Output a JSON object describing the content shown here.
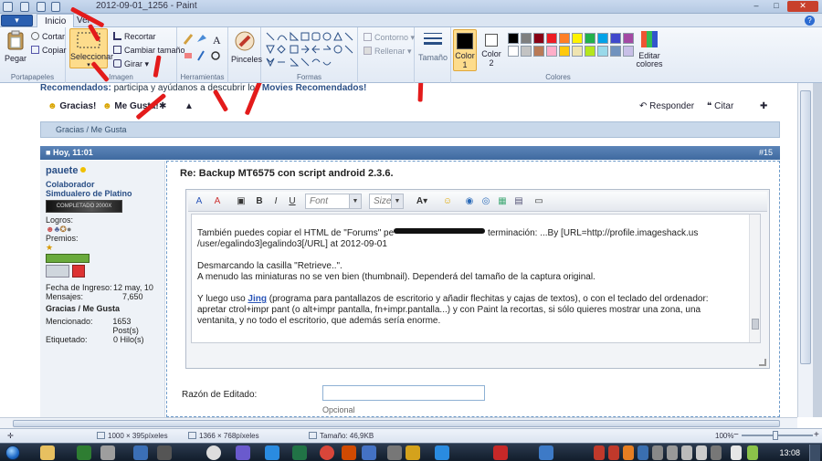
{
  "window": {
    "title": "2012-09-01_1256 - Paint",
    "minimize": "–",
    "maximize": "□",
    "close": "✕"
  },
  "tabs": {
    "file": "▾",
    "home": "Inicio",
    "view": "Ver",
    "help": "?"
  },
  "ribbon": {
    "portapapeles": {
      "paste": "Pegar",
      "cut": "Cortar",
      "copy": "Copiar",
      "group": "Portapapeles"
    },
    "imagen": {
      "select": "Seleccionar",
      "crop": "Recortar",
      "resize": "Cambiar tamaño",
      "rotate": "Girar",
      "group": "Imagen"
    },
    "herramientas": {
      "group": "Herramientas"
    },
    "pinceles": {
      "label": "Pinceles"
    },
    "formas": {
      "outline": "Contorno",
      "fill": "Rellenar",
      "group": "Formas"
    },
    "tamano": {
      "label": "Tamaño"
    },
    "colores": {
      "color1": "Color 1",
      "color2": "Color 2",
      "edit": "Editar colores",
      "group": "Colores",
      "active1": "#000000",
      "active2": "#ffffff",
      "palette": [
        "#000000",
        "#7f7f7f",
        "#880015",
        "#ed1c24",
        "#ff7f27",
        "#fff200",
        "#22b14c",
        "#00a2e8",
        "#3f48cc",
        "#a349a4",
        "#ffffff",
        "#c3c3c3",
        "#b97a57",
        "#ffaec9",
        "#ffc90e",
        "#efe4b0",
        "#b5e61d",
        "#99d9ea",
        "#7092be",
        "#c8bfe7"
      ]
    }
  },
  "forum": {
    "topline_lead": "Recomendados:",
    "topline_text": " participa y ayúdanos a descubrir los ",
    "topline_link": "Movies Recomendados!",
    "gracias": "Gracias!",
    "megusta": "Me Gusta!",
    "responder": "Responder",
    "citar": "Citar",
    "thanks_bar": "Gracias / Me Gusta",
    "post_date": "Hoy, 11:01",
    "post_num": "#15",
    "user": {
      "name": "pauete",
      "role1": "Colaborador",
      "role2": "Simdualero de Platino",
      "bar_label": "COMPLETADO 2000X",
      "logros": "Logros:",
      "premios": "Premios:",
      "stats": [
        {
          "k": "Fecha de Ingreso:",
          "v": "12 may, 10"
        },
        {
          "k": "Mensajes:",
          "v": "7,650"
        }
      ],
      "gracias_label": "Gracias / Me Gusta",
      "stats2": [
        {
          "k": "Mencionado:",
          "v": "1653 Post(s)"
        },
        {
          "k": "Etiquetado:",
          "v": "0 Hilo(s)"
        }
      ]
    },
    "post_title": "Re: Backup MT6575 con script android 2.3.6.",
    "editor": {
      "font": "Font",
      "size": "Size",
      "text1a": "También puedes copiar el HTML de \"Forums\" pe",
      "text1b": " terminación: ...By [URL=http://profile.imageshack.us",
      "text1c": "/user/egalindo3]egalindo3[/URL] at 2012-09-01",
      "text2a": "Desmarcando la casilla \"Retrieve..\".",
      "text2b": "A menudo las miniaturas no se ven bien (thumbnail). Dependerá del tamaño de la captura original.",
      "text3pre": "Y luego uso ",
      "text3link": "Jing",
      "text3post": " (programa para pantallazos de escritorio y añadir flechitas y cajas de textos), o con el teclado del ordenador: apretar ctrol+impr pant (o alt+impr pantalla, fn+impr.pantalla...) y con Paint la recortas, si sólo quieres mostrar una zona, una ventanita, y no todo el escritorio, que además sería enorme."
    },
    "razon": "Razón de Editado:",
    "opcional": "Opcional"
  },
  "status": {
    "selection": "1000 × 395píxeles",
    "canvas": "1366 × 768píxeles",
    "filesize": "Tamaño: 46,9KB",
    "zoom": "100%",
    "zoom_minus": "−",
    "zoom_plus": "+"
  },
  "taskbar": {
    "clock": "13:08"
  }
}
